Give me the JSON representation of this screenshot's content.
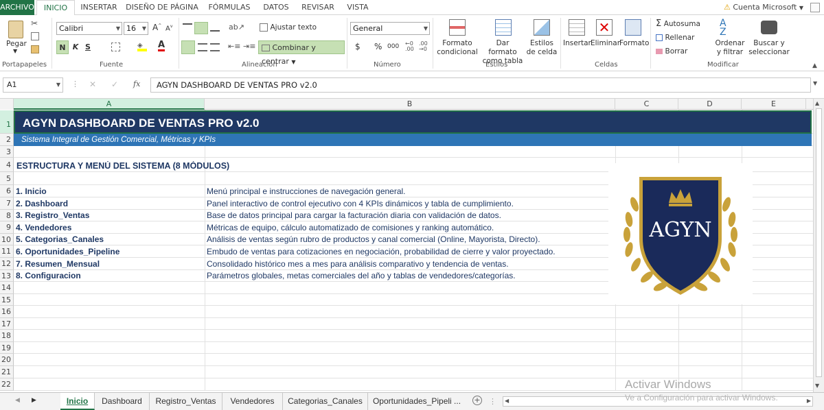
{
  "menu": {
    "file": "ARCHIVO",
    "tabs": [
      "INICIO",
      "INSERTAR",
      "DISEÑO DE PÁGINA",
      "FÓRMULAS",
      "DATOS",
      "REVISAR",
      "VISTA"
    ],
    "account": "Cuenta Microsoft"
  },
  "ribbon": {
    "clipboard": {
      "paste": "Pegar",
      "label": "Portapapeles"
    },
    "font": {
      "name": "Calibri",
      "size": "16",
      "bold": "N",
      "italic": "K",
      "underline": "S",
      "label": "Fuente"
    },
    "alignment": {
      "wrap": "Ajustar texto",
      "merge": "Combinar y centrar",
      "label": "Alineación"
    },
    "number": {
      "format": "General",
      "currency": "$",
      "percent": "%",
      "thousands": "000",
      "label": "Número"
    },
    "styles": {
      "conditional": "Formato condicional",
      "as_table": "Dar formato como tabla",
      "cell_styles": "Estilos de celda",
      "label": "Estilos"
    },
    "cells": {
      "insert": "Insertar",
      "delete": "Eliminar",
      "format": "Formato",
      "label": "Celdas"
    },
    "editing": {
      "autosum": "Autosuma",
      "fill": "Rellenar",
      "clear": "Borrar",
      "sort": "Ordenar y filtrar",
      "find": "Buscar y seleccionar",
      "label": "Modificar"
    }
  },
  "formula_bar": {
    "name_box": "A1",
    "fx": "fx",
    "content": "AGYN DASHBOARD DE VENTAS PRO v2.0"
  },
  "columns": [
    "A",
    "B",
    "C",
    "D",
    "E"
  ],
  "rows": [
    "1",
    "2",
    "3",
    "4",
    "5",
    "6",
    "7",
    "8",
    "9",
    "10",
    "11",
    "12",
    "13",
    "14",
    "15",
    "16",
    "17",
    "18",
    "19",
    "20",
    "21",
    "22"
  ],
  "sheet": {
    "title": "AGYN DASHBOARD DE VENTAS PRO v2.0",
    "subtitle": "Sistema Integral de Gestión Comercial, Métricas y KPIs",
    "section_header": "ESTRUCTURA Y MENÚ DEL SISTEMA (8 MÓDULOS)",
    "modules": [
      {
        "name": "1. Inicio",
        "desc": "Menú principal e instrucciones de navegación general."
      },
      {
        "name": "2. Dashboard",
        "desc": "Panel interactivo de control ejecutivo con 4 KPIs dinámicos y tabla de cumplimiento."
      },
      {
        "name": "3. Registro_Ventas",
        "desc": "Base de datos principal para cargar la facturación diaria con validación de datos."
      },
      {
        "name": "4. Vendedores",
        "desc": "Métricas de equipo, cálculo automatizado de comisiones y ranking automático."
      },
      {
        "name": "5. Categorias_Canales",
        "desc": "Análisis de ventas según rubro de productos y canal comercial (Online, Mayorista, Directo)."
      },
      {
        "name": "6. Oportunidades_Pipeline",
        "desc": "Embudo de ventas para cotizaciones en negociación, probabilidad de cierre y valor proyectado."
      },
      {
        "name": "7. Resumen_Mensual",
        "desc": "Consolidado histórico mes a mes para análisis comparativo y tendencia de ventas."
      },
      {
        "name": "8. Configuracion",
        "desc": "Parámetros globales, metas comerciales del año y tablas de vendedores/categorías."
      }
    ],
    "logo_text": "AGYN"
  },
  "sheet_tabs": [
    "Inicio",
    "Dashboard",
    "Registro_Ventas",
    "Vendedores",
    "Categorias_Canales",
    "Oportunidades_Pipeli ..."
  ],
  "watermark": {
    "line1": "Activar Windows",
    "line2": "Ve a Configuración para activar Windows."
  },
  "colors": {
    "excel_green": "#217346",
    "banner_dark": "#1f3864",
    "banner_blue": "#2e75b6",
    "logo_navy": "#1a2a5a",
    "logo_gold": "#c9a23a"
  }
}
